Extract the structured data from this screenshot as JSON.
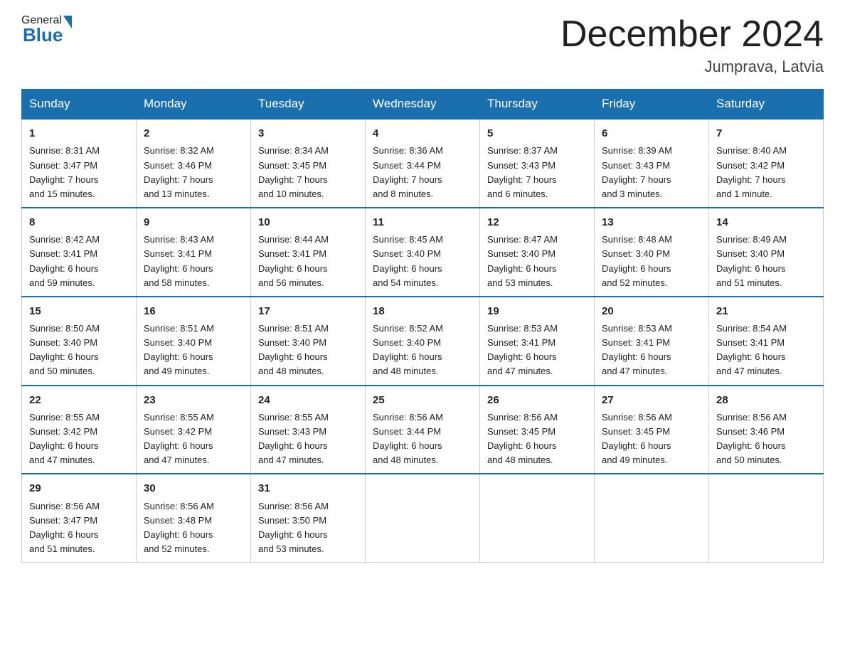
{
  "header": {
    "logo_general": "General",
    "logo_blue": "Blue",
    "title": "December 2024",
    "location": "Jumprava, Latvia"
  },
  "days_of_week": [
    "Sunday",
    "Monday",
    "Tuesday",
    "Wednesday",
    "Thursday",
    "Friday",
    "Saturday"
  ],
  "weeks": [
    [
      {
        "day": "1",
        "sunrise": "8:31 AM",
        "sunset": "3:47 PM",
        "daylight": "7 hours and 15 minutes."
      },
      {
        "day": "2",
        "sunrise": "8:32 AM",
        "sunset": "3:46 PM",
        "daylight": "7 hours and 13 minutes."
      },
      {
        "day": "3",
        "sunrise": "8:34 AM",
        "sunset": "3:45 PM",
        "daylight": "7 hours and 10 minutes."
      },
      {
        "day": "4",
        "sunrise": "8:36 AM",
        "sunset": "3:44 PM",
        "daylight": "7 hours and 8 minutes."
      },
      {
        "day": "5",
        "sunrise": "8:37 AM",
        "sunset": "3:43 PM",
        "daylight": "7 hours and 6 minutes."
      },
      {
        "day": "6",
        "sunrise": "8:39 AM",
        "sunset": "3:43 PM",
        "daylight": "7 hours and 3 minutes."
      },
      {
        "day": "7",
        "sunrise": "8:40 AM",
        "sunset": "3:42 PM",
        "daylight": "7 hours and 1 minute."
      }
    ],
    [
      {
        "day": "8",
        "sunrise": "8:42 AM",
        "sunset": "3:41 PM",
        "daylight": "6 hours and 59 minutes."
      },
      {
        "day": "9",
        "sunrise": "8:43 AM",
        "sunset": "3:41 PM",
        "daylight": "6 hours and 58 minutes."
      },
      {
        "day": "10",
        "sunrise": "8:44 AM",
        "sunset": "3:41 PM",
        "daylight": "6 hours and 56 minutes."
      },
      {
        "day": "11",
        "sunrise": "8:45 AM",
        "sunset": "3:40 PM",
        "daylight": "6 hours and 54 minutes."
      },
      {
        "day": "12",
        "sunrise": "8:47 AM",
        "sunset": "3:40 PM",
        "daylight": "6 hours and 53 minutes."
      },
      {
        "day": "13",
        "sunrise": "8:48 AM",
        "sunset": "3:40 PM",
        "daylight": "6 hours and 52 minutes."
      },
      {
        "day": "14",
        "sunrise": "8:49 AM",
        "sunset": "3:40 PM",
        "daylight": "6 hours and 51 minutes."
      }
    ],
    [
      {
        "day": "15",
        "sunrise": "8:50 AM",
        "sunset": "3:40 PM",
        "daylight": "6 hours and 50 minutes."
      },
      {
        "day": "16",
        "sunrise": "8:51 AM",
        "sunset": "3:40 PM",
        "daylight": "6 hours and 49 minutes."
      },
      {
        "day": "17",
        "sunrise": "8:51 AM",
        "sunset": "3:40 PM",
        "daylight": "6 hours and 48 minutes."
      },
      {
        "day": "18",
        "sunrise": "8:52 AM",
        "sunset": "3:40 PM",
        "daylight": "6 hours and 48 minutes."
      },
      {
        "day": "19",
        "sunrise": "8:53 AM",
        "sunset": "3:41 PM",
        "daylight": "6 hours and 47 minutes."
      },
      {
        "day": "20",
        "sunrise": "8:53 AM",
        "sunset": "3:41 PM",
        "daylight": "6 hours and 47 minutes."
      },
      {
        "day": "21",
        "sunrise": "8:54 AM",
        "sunset": "3:41 PM",
        "daylight": "6 hours and 47 minutes."
      }
    ],
    [
      {
        "day": "22",
        "sunrise": "8:55 AM",
        "sunset": "3:42 PM",
        "daylight": "6 hours and 47 minutes."
      },
      {
        "day": "23",
        "sunrise": "8:55 AM",
        "sunset": "3:42 PM",
        "daylight": "6 hours and 47 minutes."
      },
      {
        "day": "24",
        "sunrise": "8:55 AM",
        "sunset": "3:43 PM",
        "daylight": "6 hours and 47 minutes."
      },
      {
        "day": "25",
        "sunrise": "8:56 AM",
        "sunset": "3:44 PM",
        "daylight": "6 hours and 48 minutes."
      },
      {
        "day": "26",
        "sunrise": "8:56 AM",
        "sunset": "3:45 PM",
        "daylight": "6 hours and 48 minutes."
      },
      {
        "day": "27",
        "sunrise": "8:56 AM",
        "sunset": "3:45 PM",
        "daylight": "6 hours and 49 minutes."
      },
      {
        "day": "28",
        "sunrise": "8:56 AM",
        "sunset": "3:46 PM",
        "daylight": "6 hours and 50 minutes."
      }
    ],
    [
      {
        "day": "29",
        "sunrise": "8:56 AM",
        "sunset": "3:47 PM",
        "daylight": "6 hours and 51 minutes."
      },
      {
        "day": "30",
        "sunrise": "8:56 AM",
        "sunset": "3:48 PM",
        "daylight": "6 hours and 52 minutes."
      },
      {
        "day": "31",
        "sunrise": "8:56 AM",
        "sunset": "3:50 PM",
        "daylight": "6 hours and 53 minutes."
      },
      null,
      null,
      null,
      null
    ]
  ],
  "labels": {
    "sunrise": "Sunrise:",
    "sunset": "Sunset:",
    "daylight": "Daylight:"
  }
}
